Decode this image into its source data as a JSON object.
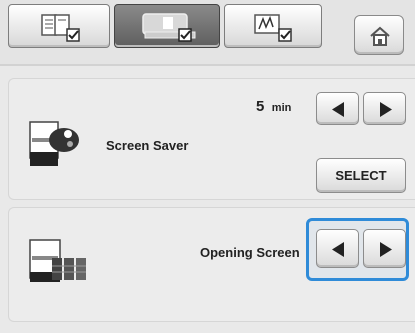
{
  "colors": {
    "highlight": "#2f8bd8",
    "panel": "#ececec",
    "background": "#e9e9e9"
  },
  "tabs": [
    {
      "icon": "settings-page-1-icon"
    },
    {
      "icon": "embroidery-settings-icon",
      "active": true
    },
    {
      "icon": "sewing-settings-icon"
    }
  ],
  "home": {
    "icon": "home-icon"
  },
  "screen_saver": {
    "label": "Screen Saver",
    "time_value": "5",
    "time_unit": "min",
    "left_icon": "screensaver-icon",
    "select_label": "SELECT"
  },
  "opening_screen": {
    "label": "Opening Screen",
    "left_icon": "opening-screen-icon"
  }
}
